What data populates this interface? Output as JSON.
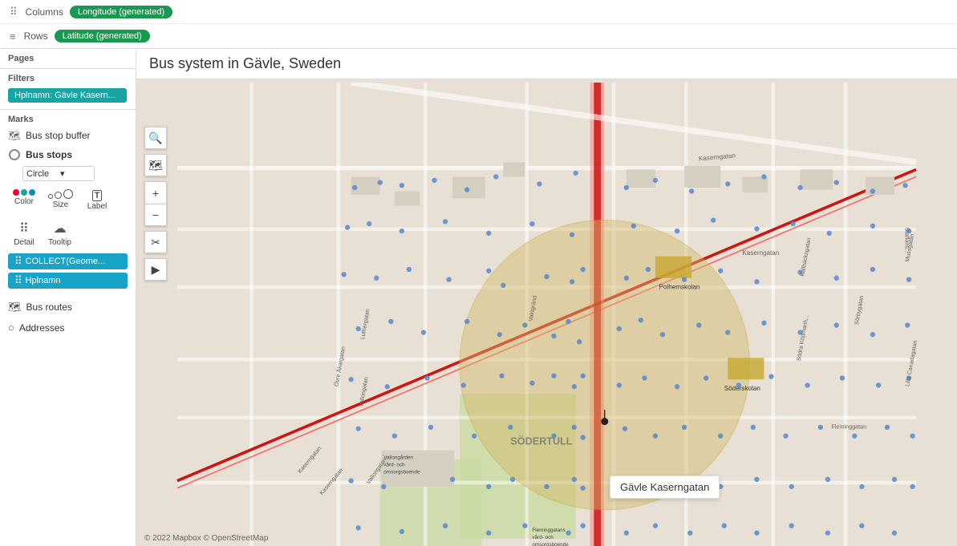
{
  "topbar": {
    "columns_icon": "⠿",
    "columns_label": "Columns",
    "columns_value": "Longitude (generated)",
    "rows_icon": "≡",
    "rows_label": "Rows",
    "rows_value": "Latitude (generated)"
  },
  "left_panel": {
    "pages_label": "Pages",
    "filters_label": "Filters",
    "filter_chip": "Hplnamn: Gävle Kasern...",
    "marks_label": "Marks",
    "mark1_label": "Bus stop buffer",
    "mark2_label": "Bus stops",
    "shape_value": "Circle",
    "color_ctrl": "Color",
    "size_ctrl": "Size",
    "label_ctrl": "Label",
    "detail_ctrl": "Detail",
    "tooltip_ctrl": "Tooltip",
    "chip1_label": "COLLECT(Geome...",
    "chip2_label": "Hplnamn",
    "bus_routes_label": "Bus routes",
    "addresses_label": "Addresses"
  },
  "map": {
    "title": "Bus system in Gävle, Sweden",
    "tooltip_text": "Gävle Kaserngatan",
    "attribution": "© 2022 Mapbox © OpenStreetMap",
    "zoom_in": "+",
    "zoom_out": "−",
    "controls": [
      "🔍",
      "🗺",
      "✂",
      "▶"
    ]
  }
}
